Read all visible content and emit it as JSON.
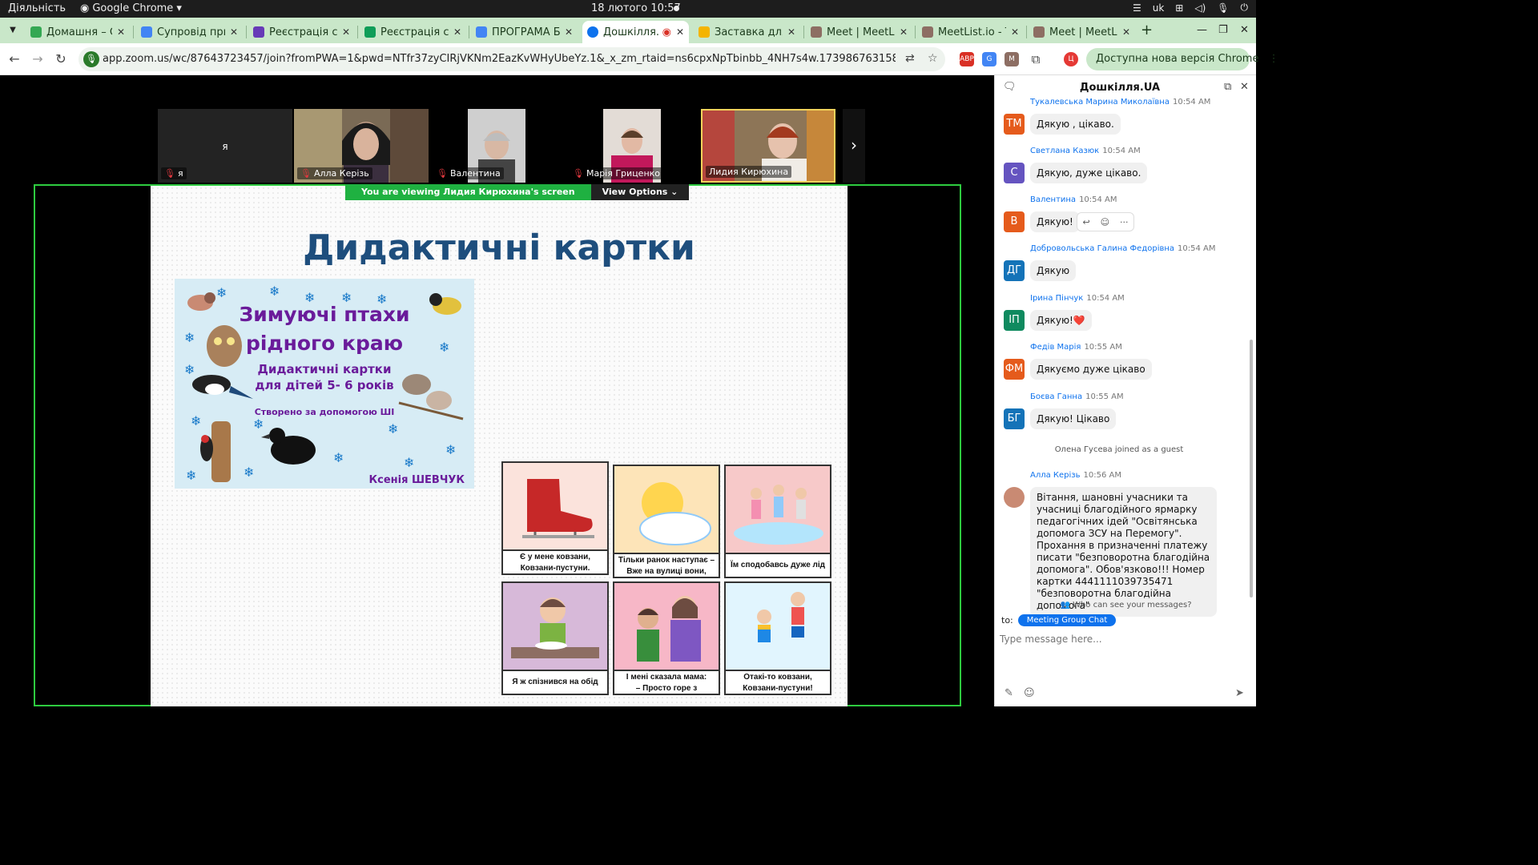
{
  "os_bar": {
    "activities": "Діяльність",
    "app_name": "Google Chrome",
    "datetime": "18 лютого  10:57",
    "lang": "uk"
  },
  "tabs": [
    {
      "label": "Домашня – Gc",
      "color": "#34a853"
    },
    {
      "label": "Супровід прир",
      "color": "#4285f4"
    },
    {
      "label": "Реєстрація сл",
      "color": "#673ab7"
    },
    {
      "label": "Реєстрація сл",
      "color": "#0f9d58"
    },
    {
      "label": "ПРОГРАМА Б",
      "color": "#4285f4"
    },
    {
      "label": "Дошкілля.",
      "color": "#0e72ed",
      "active": true
    },
    {
      "label": "Заставка для",
      "color": "#f4b400"
    },
    {
      "label": "Meet | MeetLis",
      "color": "#8d6e63"
    },
    {
      "label": "MeetList.io - T",
      "color": "#8d6e63"
    },
    {
      "label": "Meet | MeetLis",
      "color": "#8d6e63"
    }
  ],
  "address": {
    "url": "app.zoom.us/wc/87643723457/join?fromPWA=1&pwd=NTfr37zyCIRjVKNm2EazKvWHyUbeYz.1&_x_zm_rtaid=ns6cpxNpTbinbb_4NH7s4w.1739867631584.2125edc8090e7e5aa21f663e9440...",
    "update_label": "Доступна нова версія Chrome"
  },
  "participants": [
    {
      "name": "я",
      "self": true
    },
    {
      "name": "Алла Керізь"
    },
    {
      "name": "Валентина"
    },
    {
      "name": "Марія Гриценко"
    },
    {
      "name": "Лидия Кирюхина"
    }
  ],
  "share_bar": {
    "viewing": "You are viewing  Лидия Кирюхина's screen",
    "options": "View Options"
  },
  "slide": {
    "title": "Дидактичні картки",
    "poster": {
      "line1": "Зимуючі птахи",
      "line2": "рідного краю",
      "line3": "Дидактичні картки",
      "line4": "для дітей 5- 6 років",
      "line5": "Створено за допомогою ШІ",
      "author": "Ксенія ШЕВЧУК"
    },
    "cards": [
      {
        "line1": "Є у мене ковзани,",
        "line2": "Ковзани-пустуни."
      },
      {
        "line1": "Тільки ранок наступає –",
        "line2": "Вже на вулиці вони,"
      },
      {
        "line1": "Їм сподобавсь дуже лід",
        "line2": ""
      },
      {
        "line1": "Я ж спізнився на обід",
        "line2": ""
      },
      {
        "line1": "І мені сказала мама:",
        "line2": "– Просто горе з ковзанами!"
      },
      {
        "line1": "Отакі-то ковзани,",
        "line2": "Ковзани-пустуни!"
      }
    ]
  },
  "chat": {
    "title": "Дошкілля.UA",
    "messages": [
      {
        "name": "Тукалевська Марина Миколаївна",
        "time": "10:54 AM",
        "initials": "ТМ",
        "color": "#e55b1c",
        "text": "Дякую , цікаво."
      },
      {
        "name": "Светлана Казюк",
        "time": "10:54 AM",
        "initials": "С",
        "color": "#6554c0",
        "text": "Дякую, дуже цікаво."
      },
      {
        "name": "Валентина",
        "time": "10:54 AM",
        "initials": "В",
        "color": "#e55b1c",
        "text": "Дякую!"
      },
      {
        "name": "Добровольська Галина Федорівна",
        "time": "10:54 AM",
        "initials": "ДГ",
        "color": "#1473b8",
        "text": "Дякую"
      },
      {
        "name": "Ірина Пінчук",
        "time": "10:54 AM",
        "initials": "ІП",
        "color": "#0f8a5f",
        "text": "Дякую!❤️"
      },
      {
        "name": "Федів Марія",
        "time": "10:55 AM",
        "initials": "ФМ",
        "color": "#e55b1c",
        "text": "Дякуємо дуже цікаво"
      },
      {
        "name": "Боєва Ганна",
        "time": "10:55 AM",
        "initials": "БГ",
        "color": "#1473b8",
        "text": "Дякую! Цікаво"
      }
    ],
    "system_msg": "Олена Гусева joined as a guest",
    "last": {
      "name": "Алла Керізь",
      "time": "10:56 AM",
      "text": "Вітання, шановні учасники та учасниці благодійного ярмарку педагогічних ідей \"Освітянська допомога ЗСУ на Перемогу\". Прохання в призначенні платежу писати \"безповоротна благодійна допомога\". Обов'язково!!! Номер картки 4441111039735471 \"безповоротна благодійна допомога\""
    },
    "who_can_see": "Who can see your messages?",
    "to_label": "to:",
    "to_target": "Meeting Group Chat",
    "input_placeholder": "Type message here..."
  }
}
